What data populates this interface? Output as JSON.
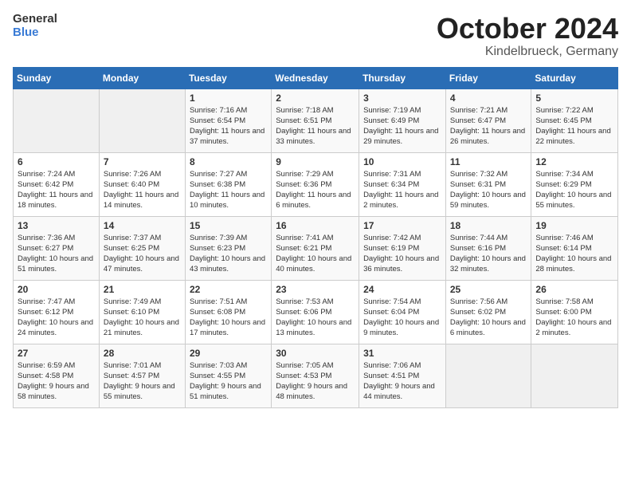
{
  "header": {
    "logo_general": "General",
    "logo_blue": "Blue",
    "month": "October 2024",
    "location": "Kindelbrueck, Germany"
  },
  "weekdays": [
    "Sunday",
    "Monday",
    "Tuesday",
    "Wednesday",
    "Thursday",
    "Friday",
    "Saturday"
  ],
  "weeks": [
    [
      {
        "day": "",
        "sunrise": "",
        "sunset": "",
        "daylight": ""
      },
      {
        "day": "",
        "sunrise": "",
        "sunset": "",
        "daylight": ""
      },
      {
        "day": "1",
        "sunrise": "Sunrise: 7:16 AM",
        "sunset": "Sunset: 6:54 PM",
        "daylight": "Daylight: 11 hours and 37 minutes."
      },
      {
        "day": "2",
        "sunrise": "Sunrise: 7:18 AM",
        "sunset": "Sunset: 6:51 PM",
        "daylight": "Daylight: 11 hours and 33 minutes."
      },
      {
        "day": "3",
        "sunrise": "Sunrise: 7:19 AM",
        "sunset": "Sunset: 6:49 PM",
        "daylight": "Daylight: 11 hours and 29 minutes."
      },
      {
        "day": "4",
        "sunrise": "Sunrise: 7:21 AM",
        "sunset": "Sunset: 6:47 PM",
        "daylight": "Daylight: 11 hours and 26 minutes."
      },
      {
        "day": "5",
        "sunrise": "Sunrise: 7:22 AM",
        "sunset": "Sunset: 6:45 PM",
        "daylight": "Daylight: 11 hours and 22 minutes."
      }
    ],
    [
      {
        "day": "6",
        "sunrise": "Sunrise: 7:24 AM",
        "sunset": "Sunset: 6:42 PM",
        "daylight": "Daylight: 11 hours and 18 minutes."
      },
      {
        "day": "7",
        "sunrise": "Sunrise: 7:26 AM",
        "sunset": "Sunset: 6:40 PM",
        "daylight": "Daylight: 11 hours and 14 minutes."
      },
      {
        "day": "8",
        "sunrise": "Sunrise: 7:27 AM",
        "sunset": "Sunset: 6:38 PM",
        "daylight": "Daylight: 11 hours and 10 minutes."
      },
      {
        "day": "9",
        "sunrise": "Sunrise: 7:29 AM",
        "sunset": "Sunset: 6:36 PM",
        "daylight": "Daylight: 11 hours and 6 minutes."
      },
      {
        "day": "10",
        "sunrise": "Sunrise: 7:31 AM",
        "sunset": "Sunset: 6:34 PM",
        "daylight": "Daylight: 11 hours and 2 minutes."
      },
      {
        "day": "11",
        "sunrise": "Sunrise: 7:32 AM",
        "sunset": "Sunset: 6:31 PM",
        "daylight": "Daylight: 10 hours and 59 minutes."
      },
      {
        "day": "12",
        "sunrise": "Sunrise: 7:34 AM",
        "sunset": "Sunset: 6:29 PM",
        "daylight": "Daylight: 10 hours and 55 minutes."
      }
    ],
    [
      {
        "day": "13",
        "sunrise": "Sunrise: 7:36 AM",
        "sunset": "Sunset: 6:27 PM",
        "daylight": "Daylight: 10 hours and 51 minutes."
      },
      {
        "day": "14",
        "sunrise": "Sunrise: 7:37 AM",
        "sunset": "Sunset: 6:25 PM",
        "daylight": "Daylight: 10 hours and 47 minutes."
      },
      {
        "day": "15",
        "sunrise": "Sunrise: 7:39 AM",
        "sunset": "Sunset: 6:23 PM",
        "daylight": "Daylight: 10 hours and 43 minutes."
      },
      {
        "day": "16",
        "sunrise": "Sunrise: 7:41 AM",
        "sunset": "Sunset: 6:21 PM",
        "daylight": "Daylight: 10 hours and 40 minutes."
      },
      {
        "day": "17",
        "sunrise": "Sunrise: 7:42 AM",
        "sunset": "Sunset: 6:19 PM",
        "daylight": "Daylight: 10 hours and 36 minutes."
      },
      {
        "day": "18",
        "sunrise": "Sunrise: 7:44 AM",
        "sunset": "Sunset: 6:16 PM",
        "daylight": "Daylight: 10 hours and 32 minutes."
      },
      {
        "day": "19",
        "sunrise": "Sunrise: 7:46 AM",
        "sunset": "Sunset: 6:14 PM",
        "daylight": "Daylight: 10 hours and 28 minutes."
      }
    ],
    [
      {
        "day": "20",
        "sunrise": "Sunrise: 7:47 AM",
        "sunset": "Sunset: 6:12 PM",
        "daylight": "Daylight: 10 hours and 24 minutes."
      },
      {
        "day": "21",
        "sunrise": "Sunrise: 7:49 AM",
        "sunset": "Sunset: 6:10 PM",
        "daylight": "Daylight: 10 hours and 21 minutes."
      },
      {
        "day": "22",
        "sunrise": "Sunrise: 7:51 AM",
        "sunset": "Sunset: 6:08 PM",
        "daylight": "Daylight: 10 hours and 17 minutes."
      },
      {
        "day": "23",
        "sunrise": "Sunrise: 7:53 AM",
        "sunset": "Sunset: 6:06 PM",
        "daylight": "Daylight: 10 hours and 13 minutes."
      },
      {
        "day": "24",
        "sunrise": "Sunrise: 7:54 AM",
        "sunset": "Sunset: 6:04 PM",
        "daylight": "Daylight: 10 hours and 9 minutes."
      },
      {
        "day": "25",
        "sunrise": "Sunrise: 7:56 AM",
        "sunset": "Sunset: 6:02 PM",
        "daylight": "Daylight: 10 hours and 6 minutes."
      },
      {
        "day": "26",
        "sunrise": "Sunrise: 7:58 AM",
        "sunset": "Sunset: 6:00 PM",
        "daylight": "Daylight: 10 hours and 2 minutes."
      }
    ],
    [
      {
        "day": "27",
        "sunrise": "Sunrise: 6:59 AM",
        "sunset": "Sunset: 4:58 PM",
        "daylight": "Daylight: 9 hours and 58 minutes."
      },
      {
        "day": "28",
        "sunrise": "Sunrise: 7:01 AM",
        "sunset": "Sunset: 4:57 PM",
        "daylight": "Daylight: 9 hours and 55 minutes."
      },
      {
        "day": "29",
        "sunrise": "Sunrise: 7:03 AM",
        "sunset": "Sunset: 4:55 PM",
        "daylight": "Daylight: 9 hours and 51 minutes."
      },
      {
        "day": "30",
        "sunrise": "Sunrise: 7:05 AM",
        "sunset": "Sunset: 4:53 PM",
        "daylight": "Daylight: 9 hours and 48 minutes."
      },
      {
        "day": "31",
        "sunrise": "Sunrise: 7:06 AM",
        "sunset": "Sunset: 4:51 PM",
        "daylight": "Daylight: 9 hours and 44 minutes."
      },
      {
        "day": "",
        "sunrise": "",
        "sunset": "",
        "daylight": ""
      },
      {
        "day": "",
        "sunrise": "",
        "sunset": "",
        "daylight": ""
      }
    ]
  ]
}
